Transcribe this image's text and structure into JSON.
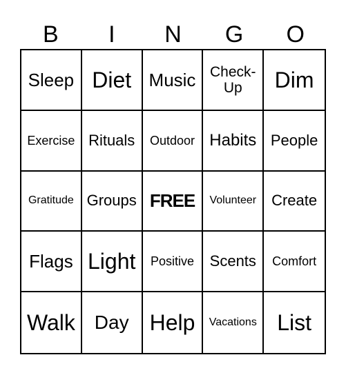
{
  "header": {
    "letters": [
      "B",
      "I",
      "N",
      "G",
      "O"
    ]
  },
  "card": {
    "rows": [
      [
        "Sleep",
        "Diet",
        "Music",
        "Check-Up",
        "Dim"
      ],
      [
        "Exercise",
        "Rituals",
        "Outdoor",
        "Habits",
        "People"
      ],
      [
        "Gratitude",
        "Groups",
        "FREE",
        "Volunteer",
        "Create"
      ],
      [
        "Flags",
        "Light",
        "Positive",
        "Scents",
        "Comfort"
      ],
      [
        "Walk",
        "Day",
        "Help",
        "Vacations",
        "List"
      ]
    ],
    "check_up_lines": [
      "Check-",
      "Up"
    ]
  }
}
